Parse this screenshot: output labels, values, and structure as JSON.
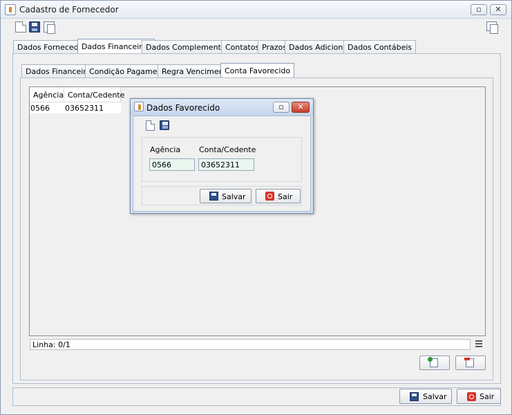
{
  "window": {
    "title": "Cadastro de Fornecedor"
  },
  "main_tabs": [
    "Dados Fornecedor",
    "Dados Financeiros",
    "Dados Complementares",
    "Contatos",
    "Prazos",
    "Dados Adicionais",
    "Dados Contábeis"
  ],
  "sub_tabs": [
    "Dados Financeiros",
    "Condição Pagamento",
    "Regra Vencimento",
    "Conta Favorecido"
  ],
  "table": {
    "columns": [
      "Agência",
      "Conta/Cedente"
    ],
    "rows": [
      {
        "agencia": "0566",
        "conta": "03652311"
      }
    ]
  },
  "status": {
    "linha": "Linha: 0/1"
  },
  "dialog": {
    "title": "Dados Favorecido",
    "agencia_label": "Agência",
    "conta_label": "Conta/Cedente",
    "agencia_value": "0566",
    "conta_value": "03652311",
    "save_label": "Salvar",
    "exit_label": "Sair"
  },
  "footer": {
    "save_label": "Salvar",
    "exit_label": "Sair"
  }
}
